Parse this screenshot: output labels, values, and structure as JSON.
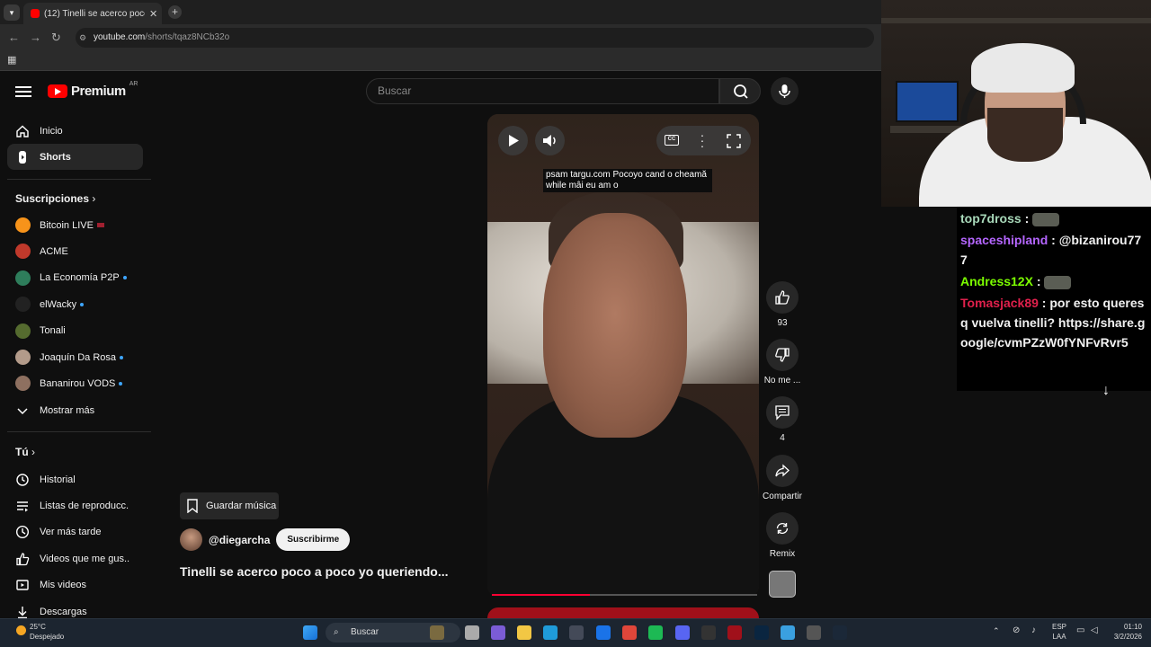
{
  "browser": {
    "tab_title": "(12) Tinelli se acerco poco a poco",
    "url_host": "youtube.com",
    "url_path": "/shorts/tqaz8NCb32o"
  },
  "header": {
    "logo_text": "Premium",
    "country": "AR",
    "search_placeholder": "Buscar"
  },
  "sidebar": {
    "main": [
      {
        "label": "Inicio",
        "icon": "home-icon"
      },
      {
        "label": "Shorts",
        "icon": "shorts-icon"
      }
    ],
    "subscriptions_title": "Suscripciones",
    "subscriptions": [
      {
        "label": "Bitcoin LIVE",
        "color": "#f7931a",
        "indicator": "live"
      },
      {
        "label": "ACME",
        "color": "#c0392b",
        "indicator": ""
      },
      {
        "label": "La Economía P2P",
        "color": "#2e7d5b",
        "indicator": "dot"
      },
      {
        "label": "elWacky",
        "color": "#222222",
        "indicator": "dot"
      },
      {
        "label": "Tonali",
        "color": "#556b2f",
        "indicator": ""
      },
      {
        "label": "Joaquín Da Rosa",
        "color": "#b39b8a",
        "indicator": "dot"
      },
      {
        "label": "Bananirou VODS",
        "color": "#8e7060",
        "indicator": "dot"
      }
    ],
    "show_more": "Mostrar más",
    "you_title": "Tú",
    "you_items": [
      {
        "label": "Historial",
        "icon": "history-icon"
      },
      {
        "label": "Listas de reproducc...",
        "icon": "playlists-icon"
      },
      {
        "label": "Ver más tarde",
        "icon": "watch-later-icon"
      },
      {
        "label": "Videos que me gus...",
        "icon": "liked-icon"
      },
      {
        "label": "Mis videos",
        "icon": "my-videos-icon"
      },
      {
        "label": "Descargas",
        "icon": "downloads-icon"
      }
    ]
  },
  "short": {
    "caption_line1": "psam targu.com Pocoyo cand o cheamă",
    "caption_line2": "while mâi eu am o",
    "progress": 0.37,
    "save_music": "Guardar música",
    "channel": "@diegarcha",
    "subscribe": "Suscribirme",
    "title": "Tinelli se acerco poco a poco yo queriendo...",
    "actions": {
      "likes": "93",
      "dislike": "No me ...",
      "comments": "4",
      "share": "Compartir",
      "remix": "Remix"
    }
  },
  "chat": {
    "messages": [
      {
        "user": "top7dross",
        "color": "#a8d8b9",
        "text": "",
        "emote": true
      },
      {
        "user": "spaceshipland",
        "color": "#b566ff",
        "text": "@bizanirou777",
        "emote": false
      },
      {
        "user": "Andress12X",
        "color": "#7cfc00",
        "text": "",
        "emote": true
      },
      {
        "user": "Tomasjack89",
        "color": "#e0204c",
        "text": "por esto queres q vuelva tinelli? https://share.google/cvmPZzW0fYNFvRvr5",
        "emote": false
      }
    ]
  },
  "taskbar": {
    "temp": "25°C",
    "weather": "Despejado",
    "search": "Buscar",
    "lang1": "ESP",
    "lang2": "LAA",
    "time": "01:10",
    "date": "3/2/2026"
  }
}
